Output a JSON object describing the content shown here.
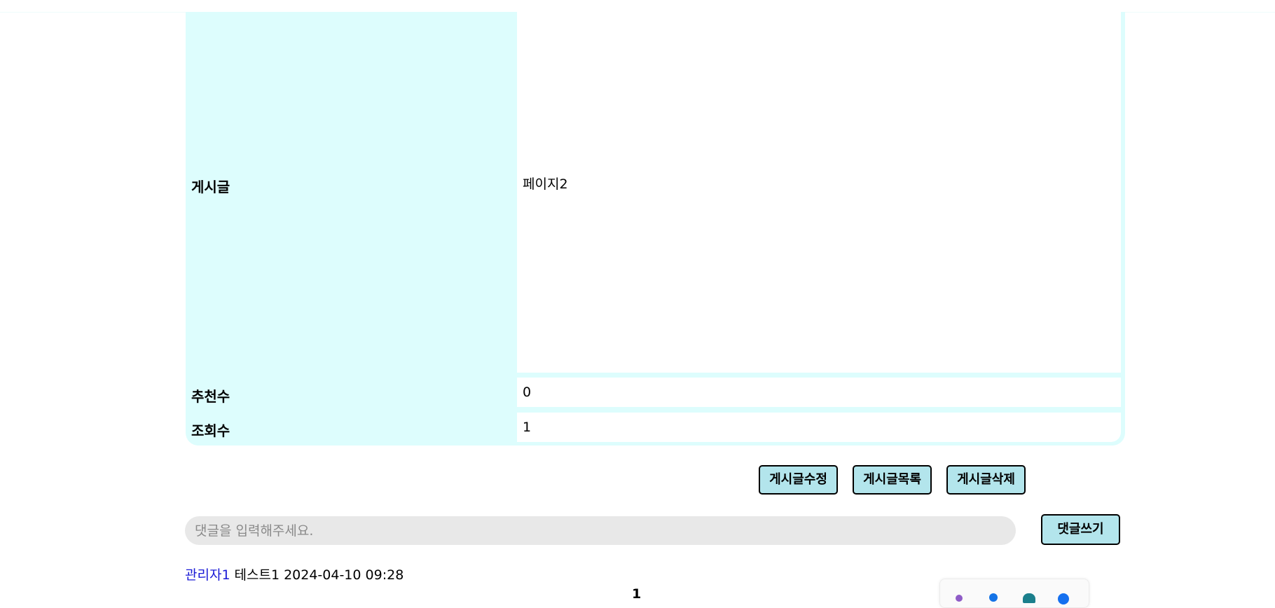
{
  "post": {
    "content_label": "게시글",
    "content_value": "페이지2",
    "recommend_label": "추천수",
    "recommend_value": "0",
    "views_label": "조회수",
    "views_value": "1"
  },
  "actions": {
    "edit_label": "게시글수정",
    "list_label": "게시글목록",
    "delete_label": "게시글삭제"
  },
  "comment_form": {
    "placeholder": "댓글을 입력해주세요.",
    "value": "",
    "submit_label": "댓글쓰기"
  },
  "comments": [
    {
      "author": "관리자1",
      "body": "테스트1",
      "date": "2024-04-10 09:28"
    }
  ],
  "pagination": {
    "current": "1"
  },
  "floating_toolbar": {
    "icons": [
      "pen-icon",
      "person-icon",
      "hat-icon",
      "circle-icon"
    ]
  },
  "colors": {
    "label_bg": "#ddfdfd",
    "button_bg": "#b3e5ec",
    "author_link": "#1a1ad6",
    "input_bg": "#e8e8e8"
  }
}
